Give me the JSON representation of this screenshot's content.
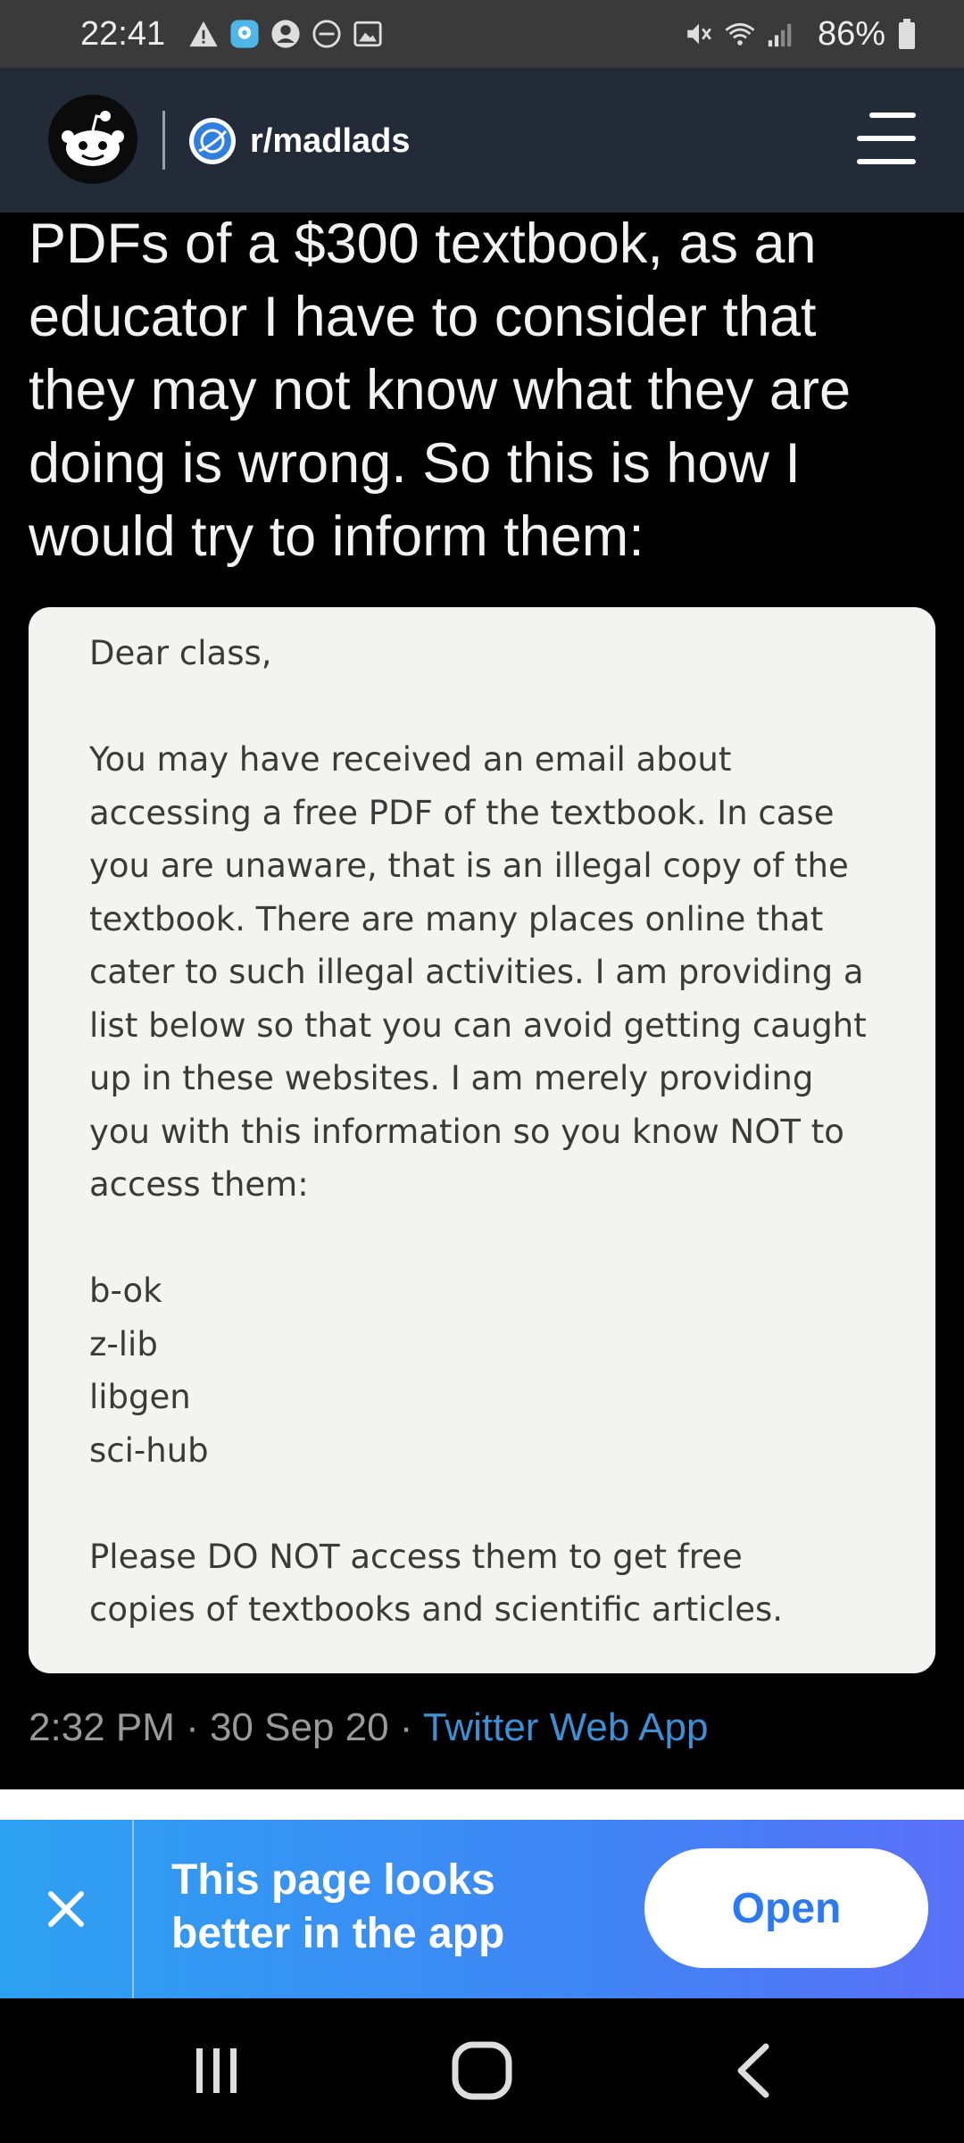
{
  "status_bar": {
    "time": "22:41",
    "battery": "86%",
    "icons": [
      "warning-icon",
      "location-icon",
      "account-icon",
      "dnd-icon",
      "image-icon",
      "mute-icon",
      "wifi-icon",
      "signal-icon",
      "battery-icon"
    ]
  },
  "header": {
    "subreddit": "r/madlads",
    "logo": "reddit-snoo-icon",
    "menu": "hamburger-menu-icon"
  },
  "tweet": {
    "text": "PDFs of a $300 textbook, as an\neducator I have to consider that\nthey may not know what they are\ndoing is wrong. So this is how I\nwould try to inform them:",
    "note": "Dear class,\n\nYou may have received an email about\naccessing a free PDF of the textbook. In case\nyou are unaware, that is an illegal copy of the\ntextbook. There are many places online that\ncater to such illegal activities. I am providing a\nlist below so that you can avoid getting caught\nup in these websites. I am merely providing\nyou with this information so you know NOT to\naccess them:\n\nb-ok\nz-lib\nlibgen\nsci-hub\n\nPlease DO NOT access them to get free\ncopies of textbooks and scientific articles.",
    "timestamp": "2:32 PM · 30 Sep 20 · ",
    "source": "Twitter Web App"
  },
  "banner": {
    "message": "This page looks\nbetter in the app",
    "open_label": "Open"
  },
  "colors": {
    "header_bg": "#232a38",
    "banner_start": "#2da1f1",
    "banner_end": "#5a70f8",
    "link": "#3d8fd6"
  }
}
